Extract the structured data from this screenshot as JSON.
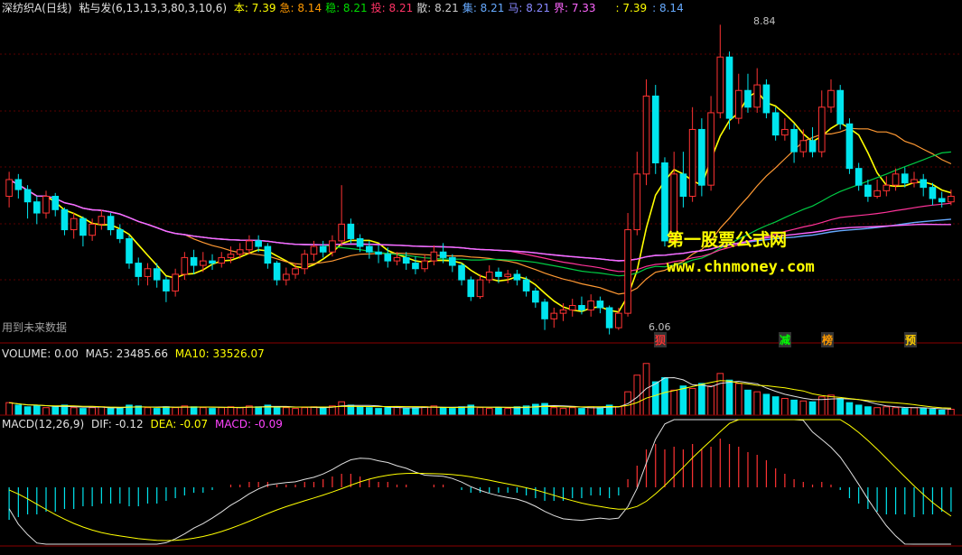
{
  "main_header": {
    "title": "深纺织A(日线)",
    "indicator": "粘与发(6,13,13,3,80,3,10,6)",
    "items": [
      {
        "label": "本",
        "value": "7.39",
        "color": "#ffff00"
      },
      {
        "label": "急",
        "value": "8.14",
        "color": "#ff9900"
      },
      {
        "label": "稳",
        "value": "8.21",
        "color": "#00dd00"
      },
      {
        "label": "投",
        "value": "8.21",
        "color": "#ff3366"
      },
      {
        "label": "散",
        "value": "8.21",
        "color": "#cccccc"
      },
      {
        "label": "集",
        "value": "8.21",
        "color": "#66aaff"
      },
      {
        "label": "马",
        "value": "8.21",
        "color": "#8888ff"
      },
      {
        "label": "界",
        "value": "7.33",
        "color": "#ff66ff"
      }
    ],
    "extra": [
      {
        "value": "7.39",
        "color": "#ffff00"
      },
      {
        "value": "8.14",
        "color": "#66aaff"
      }
    ]
  },
  "notes": {
    "future_data": "用到未来数据",
    "watermark_cn": "第一股票公式网",
    "watermark_url": "www.chnmoney.com",
    "max_price": "8.84",
    "min_price": "6.06"
  },
  "signals": [
    {
      "text": "狈",
      "color": "#ff3333",
      "bg": "#333333"
    },
    {
      "text": "减",
      "color": "#00ff00",
      "bg": "#333333"
    },
    {
      "text": "榜",
      "color": "#ff9900",
      "bg": "#333333"
    },
    {
      "text": "预",
      "color": "#ffcc00",
      "bg": "#333333"
    }
  ],
  "volume_header": {
    "label": "VOLUME: 0.00",
    "ma5": "MA5: 23485.66",
    "ma10": "MA10: 33526.07"
  },
  "macd_header": {
    "label": "MACD(12,26,9)",
    "dif": "DIF: -0.12",
    "dea": "DEA: -0.07",
    "macd": "MACD: -0.09"
  },
  "colors": {
    "up": "#ff3333",
    "down": "#00e5ee",
    "grid": "#5a0000",
    "panel_border": "#8b0000"
  },
  "chart_data": {
    "type": "candlestick",
    "price_range": [
      6.0,
      8.9
    ],
    "annotated_high": 8.84,
    "annotated_low": 6.06,
    "candles": [
      [
        7.3,
        7.45,
        7.52,
        7.2
      ],
      [
        7.45,
        7.36,
        7.5,
        7.28
      ],
      [
        7.36,
        7.25,
        7.4,
        7.1
      ],
      [
        7.25,
        7.15,
        7.3,
        7.05
      ],
      [
        7.15,
        7.3,
        7.35,
        7.1
      ],
      [
        7.3,
        7.18,
        7.33,
        7.12
      ],
      [
        7.18,
        7.0,
        7.2,
        6.95
      ],
      [
        7.0,
        7.1,
        7.15,
        6.92
      ],
      [
        7.1,
        6.95,
        7.12,
        6.85
      ],
      [
        6.95,
        7.05,
        7.1,
        6.9
      ],
      [
        7.05,
        7.12,
        7.18,
        7.0
      ],
      [
        7.12,
        7.0,
        7.15,
        6.95
      ],
      [
        7.0,
        6.92,
        7.05,
        6.88
      ],
      [
        6.92,
        6.7,
        6.95,
        6.65
      ],
      [
        6.7,
        6.58,
        6.75,
        6.5
      ],
      [
        6.58,
        6.65,
        6.7,
        6.5
      ],
      [
        6.65,
        6.55,
        6.7,
        6.48
      ],
      [
        6.55,
        6.45,
        6.58,
        6.35
      ],
      [
        6.45,
        6.6,
        6.65,
        6.4
      ],
      [
        6.6,
        6.75,
        6.8,
        6.55
      ],
      [
        6.75,
        6.68,
        6.82,
        6.6
      ],
      [
        6.68,
        6.72,
        6.8,
        6.62
      ],
      [
        6.72,
        6.7,
        6.78,
        6.64
      ],
      [
        6.7,
        6.75,
        6.8,
        6.66
      ],
      [
        6.75,
        6.78,
        6.85,
        6.7
      ],
      [
        6.78,
        6.82,
        6.88,
        6.74
      ],
      [
        6.82,
        6.9,
        6.95,
        6.78
      ],
      [
        6.9,
        6.85,
        6.95,
        6.8
      ],
      [
        6.85,
        6.7,
        6.88,
        6.65
      ],
      [
        6.7,
        6.55,
        6.72,
        6.5
      ],
      [
        6.55,
        6.6,
        6.66,
        6.5
      ],
      [
        6.6,
        6.65,
        6.7,
        6.56
      ],
      [
        6.65,
        6.78,
        6.82,
        6.6
      ],
      [
        6.78,
        6.85,
        6.9,
        6.72
      ],
      [
        6.85,
        6.8,
        6.9,
        6.75
      ],
      [
        6.8,
        6.9,
        6.95,
        6.76
      ],
      [
        6.9,
        7.05,
        7.4,
        6.85
      ],
      [
        7.05,
        6.92,
        7.1,
        6.88
      ],
      [
        6.92,
        6.85,
        6.96,
        6.8
      ],
      [
        6.85,
        6.8,
        6.9,
        6.74
      ],
      [
        6.8,
        6.78,
        6.86,
        6.7
      ],
      [
        6.78,
        6.72,
        6.84,
        6.66
      ],
      [
        6.72,
        6.75,
        6.8,
        6.68
      ],
      [
        6.75,
        6.7,
        6.8,
        6.64
      ],
      [
        6.7,
        6.65,
        6.76,
        6.6
      ],
      [
        6.65,
        6.72,
        6.78,
        6.62
      ],
      [
        6.72,
        6.8,
        6.86,
        6.68
      ],
      [
        6.8,
        6.75,
        6.88,
        6.7
      ],
      [
        6.75,
        6.68,
        6.78,
        6.62
      ],
      [
        6.68,
        6.55,
        6.7,
        6.5
      ],
      [
        6.55,
        6.4,
        6.58,
        6.36
      ],
      [
        6.4,
        6.55,
        6.6,
        6.38
      ],
      [
        6.55,
        6.62,
        6.68,
        6.52
      ],
      [
        6.62,
        6.58,
        6.66,
        6.52
      ],
      [
        6.58,
        6.6,
        6.64,
        6.52
      ],
      [
        6.6,
        6.55,
        6.64,
        6.5
      ],
      [
        6.55,
        6.45,
        6.58,
        6.4
      ],
      [
        6.45,
        6.35,
        6.48,
        6.3
      ],
      [
        6.35,
        6.2,
        6.38,
        6.1
      ],
      [
        6.2,
        6.25,
        6.3,
        6.12
      ],
      [
        6.25,
        6.28,
        6.34,
        6.18
      ],
      [
        6.28,
        6.32,
        6.38,
        6.22
      ],
      [
        6.32,
        6.28,
        6.4,
        6.24
      ],
      [
        6.28,
        6.36,
        6.42,
        6.22
      ],
      [
        6.36,
        6.3,
        6.4,
        6.25
      ],
      [
        6.3,
        6.12,
        6.32,
        6.06
      ],
      [
        6.12,
        6.25,
        6.3,
        6.1
      ],
      [
        6.25,
        7.0,
        7.15,
        6.22
      ],
      [
        7.0,
        7.5,
        7.7,
        6.95
      ],
      [
        7.5,
        8.2,
        8.35,
        7.4
      ],
      [
        8.2,
        7.6,
        8.3,
        7.5
      ],
      [
        7.6,
        6.9,
        7.65,
        6.85
      ],
      [
        6.9,
        7.5,
        7.7,
        6.88
      ],
      [
        7.5,
        7.3,
        7.7,
        7.2
      ],
      [
        7.3,
        7.9,
        8.1,
        7.25
      ],
      [
        7.9,
        7.4,
        8.0,
        7.3
      ],
      [
        7.4,
        8.05,
        8.2,
        7.35
      ],
      [
        8.05,
        8.55,
        8.84,
        8.0
      ],
      [
        8.55,
        8.0,
        8.6,
        7.9
      ],
      [
        8.0,
        8.25,
        8.4,
        7.95
      ],
      [
        8.25,
        8.1,
        8.4,
        8.05
      ],
      [
        8.1,
        8.3,
        8.45,
        8.05
      ],
      [
        8.3,
        8.05,
        8.35,
        8.0
      ],
      [
        8.05,
        7.85,
        8.1,
        7.8
      ],
      [
        7.85,
        7.9,
        8.0,
        7.8
      ],
      [
        7.9,
        7.7,
        7.95,
        7.6
      ],
      [
        7.7,
        7.8,
        7.9,
        7.65
      ],
      [
        7.8,
        7.7,
        7.92,
        7.65
      ],
      [
        7.7,
        8.1,
        8.25,
        7.65
      ],
      [
        8.1,
        8.25,
        8.35,
        8.05
      ],
      [
        8.25,
        7.95,
        8.3,
        7.9
      ],
      [
        7.95,
        7.55,
        8.0,
        7.5
      ],
      [
        7.55,
        7.4,
        7.6,
        7.35
      ],
      [
        7.4,
        7.3,
        7.45,
        7.25
      ],
      [
        7.3,
        7.35,
        7.45,
        7.28
      ],
      [
        7.35,
        7.4,
        7.48,
        7.3
      ],
      [
        7.4,
        7.5,
        7.55,
        7.35
      ],
      [
        7.5,
        7.42,
        7.56,
        7.38
      ],
      [
        7.42,
        7.45,
        7.52,
        7.38
      ],
      [
        7.45,
        7.38,
        7.5,
        7.3
      ],
      [
        7.38,
        7.28,
        7.42,
        7.22
      ],
      [
        7.28,
        7.25,
        7.34,
        7.2
      ],
      [
        7.25,
        7.3,
        7.36,
        7.22
      ]
    ],
    "volume": [
      15,
      12,
      10,
      11,
      9,
      10,
      12,
      9,
      8,
      9,
      10,
      8,
      9,
      12,
      11,
      9,
      8,
      10,
      9,
      11,
      10,
      9,
      8,
      9,
      10,
      9,
      11,
      10,
      12,
      10,
      9,
      8,
      9,
      10,
      9,
      11,
      16,
      12,
      10,
      9,
      8,
      9,
      10,
      8,
      9,
      10,
      11,
      9,
      8,
      10,
      12,
      9,
      8,
      9,
      8,
      10,
      11,
      13,
      14,
      9,
      8,
      9,
      8,
      10,
      9,
      12,
      10,
      28,
      48,
      62,
      40,
      45,
      30,
      35,
      32,
      38,
      35,
      50,
      42,
      38,
      30,
      28,
      25,
      22,
      20,
      18,
      17,
      16,
      22,
      24,
      20,
      15,
      12,
      10,
      9,
      10,
      9,
      8,
      9,
      8,
      7,
      6,
      7
    ],
    "macd_hist": [
      -0.12,
      -0.11,
      -0.1,
      -0.1,
      -0.09,
      -0.09,
      -0.08,
      -0.08,
      -0.07,
      -0.07,
      -0.06,
      -0.06,
      -0.06,
      -0.07,
      -0.07,
      -0.06,
      -0.06,
      -0.05,
      -0.04,
      -0.03,
      -0.02,
      -0.02,
      -0.01,
      0.0,
      0.01,
      0.01,
      0.02,
      0.02,
      0.02,
      0.01,
      0.01,
      0.01,
      0.02,
      0.02,
      0.03,
      0.04,
      0.05,
      0.05,
      0.04,
      0.03,
      0.02,
      0.02,
      0.01,
      0.01,
      0.0,
      0.0,
      0.01,
      0.01,
      0.0,
      -0.01,
      -0.02,
      -0.02,
      -0.02,
      -0.02,
      -0.02,
      -0.02,
      -0.03,
      -0.04,
      -0.05,
      -0.05,
      -0.05,
      -0.04,
      -0.04,
      -0.03,
      -0.03,
      -0.04,
      -0.03,
      0.03,
      0.08,
      0.14,
      0.16,
      0.14,
      0.15,
      0.14,
      0.16,
      0.14,
      0.15,
      0.18,
      0.16,
      0.15,
      0.13,
      0.12,
      0.1,
      0.07,
      0.05,
      0.03,
      0.02,
      0.01,
      0.02,
      0.01,
      -0.01,
      -0.04,
      -0.06,
      -0.08,
      -0.09,
      -0.1,
      -0.1,
      -0.1,
      -0.11,
      -0.1,
      -0.1,
      -0.09,
      -0.09
    ]
  }
}
